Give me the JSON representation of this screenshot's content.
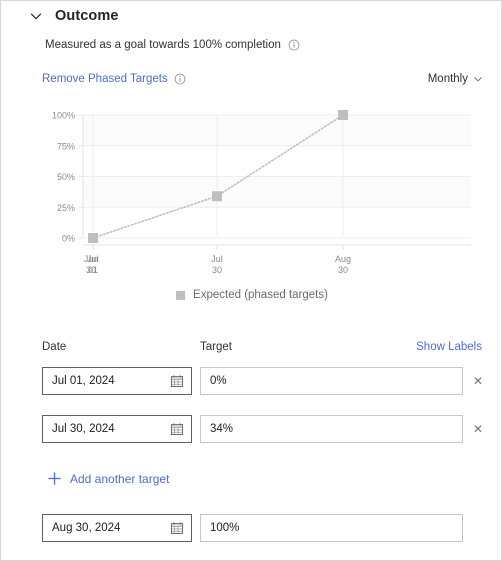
{
  "section": {
    "title": "Outcome",
    "expand_icon": "chevron-down-icon",
    "subtitle": "Measured as a goal towards 100% completion",
    "subtitle_info_icon": "info-icon",
    "remove_link": "Remove Phased Targets",
    "remove_link_info_icon": "info-icon",
    "cadence_value": "Monthly",
    "cadence_icon": "chevron-down-icon"
  },
  "chart_data": {
    "type": "line",
    "title": "",
    "xlabel": "",
    "ylabel": "",
    "categories": [
      "Jul 01",
      "Jul 30",
      "Aug 30"
    ],
    "x_tick_labels": [
      {
        "line1": "Jul",
        "line2": "01",
        "overlap_line1": "Jun",
        "overlap_line2": "30"
      },
      {
        "line1": "Jul",
        "line2": "30"
      },
      {
        "line1": "Aug",
        "line2": "30"
      }
    ],
    "series": [
      {
        "name": "Expected (phased targets)",
        "values": [
          0,
          34,
          100
        ],
        "color": "#bfbfbf",
        "line_style": "dotted",
        "marker": "square"
      }
    ],
    "ylim": [
      0,
      100
    ],
    "y_tick_labels": [
      "100%",
      "75%",
      "50%",
      "25%",
      "0%"
    ],
    "y_ticks": [
      100,
      75,
      50,
      25,
      0
    ],
    "grid": true,
    "legend_position": "bottom",
    "legend": [
      "Expected (phased targets)"
    ]
  },
  "table": {
    "headers": {
      "date": "Date",
      "target": "Target",
      "show_labels": "Show Labels"
    },
    "rows": [
      {
        "date": "Jul 01, 2024",
        "target": "0%",
        "removable": true,
        "remove_icon": "close-icon",
        "calendar_icon": "calendar-icon"
      },
      {
        "date": "Jul 30, 2024",
        "target": "34%",
        "removable": true,
        "remove_icon": "close-icon",
        "calendar_icon": "calendar-icon"
      },
      {
        "date": "Aug 30, 2024",
        "target": "100%",
        "removable": false,
        "remove_icon": "",
        "calendar_icon": "calendar-icon"
      }
    ],
    "add_label": "Add another target",
    "add_icon": "plus-icon"
  },
  "colors": {
    "link": "#4a6dd2",
    "series": "#bfbfbf",
    "text": "#323130"
  }
}
